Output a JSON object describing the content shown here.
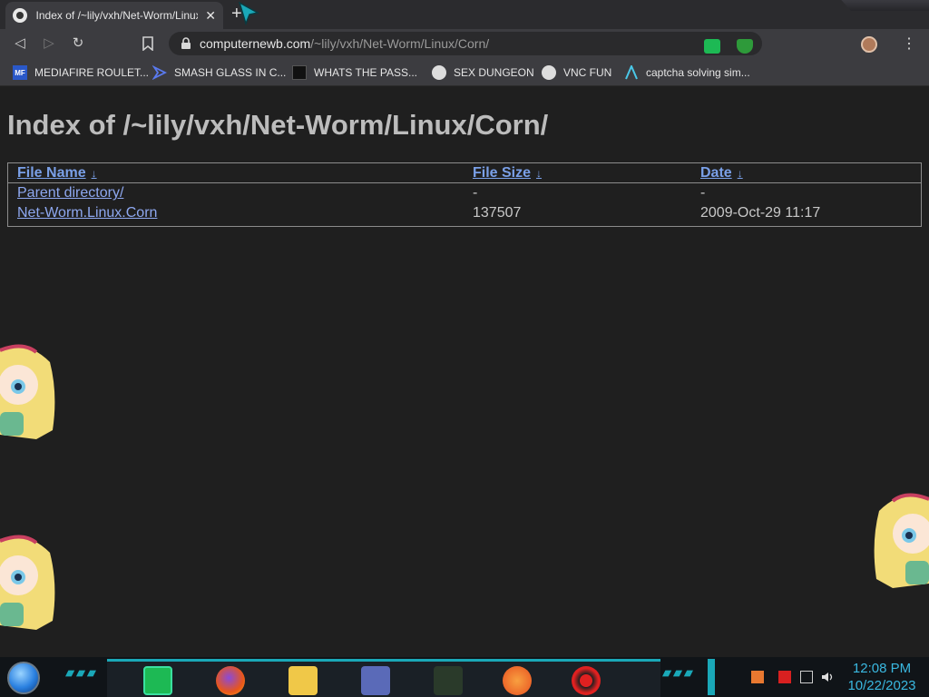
{
  "browser": {
    "tab": {
      "title": "Index of /~lily/vxh/Net-Worm/Linux/Corn/",
      "close_glyph": "✕"
    },
    "new_tab_glyph": "+",
    "nav": {
      "back": "◁",
      "forward": "▷",
      "reload": "↻",
      "bookmark": "🔖"
    },
    "url": {
      "host": "computernewb.com",
      "path": "/~lily/vxh/Net-Worm/Linux/Corn/"
    },
    "menu_glyph": "⋮",
    "bookmarks": [
      {
        "label": "MEDIAFIRE ROULET...",
        "icon": "mediafire-icon",
        "badge": "MF"
      },
      {
        "label": "SMASH GLASS IN C...",
        "icon": "smash-icon",
        "badge": ""
      },
      {
        "label": "WHATS THE PASS...",
        "icon": "lock-icon",
        "badge": ""
      },
      {
        "label": "SEX DUNGEON",
        "icon": "site-icon",
        "badge": ""
      },
      {
        "label": "VNC FUN",
        "icon": "site-icon",
        "badge": ""
      },
      {
        "label": "captcha solving sim...",
        "icon": "caret-icon",
        "badge": ""
      }
    ]
  },
  "page": {
    "heading": "Index of /~lily/vxh/Net-Worm/Linux/Corn/",
    "columns": [
      {
        "label": "File Name",
        "sort": "↓"
      },
      {
        "label": "File Size",
        "sort": "↓"
      },
      {
        "label": "Date",
        "sort": "↓"
      }
    ],
    "rows": [
      {
        "name": "Parent directory/",
        "size": "-",
        "date": "-"
      },
      {
        "name": "Net-Worm.Linux.Corn",
        "size": "137507",
        "date": "2009-Oct-29 11:17"
      }
    ]
  },
  "taskbar": {
    "apps": [
      "notes-app-icon",
      "firefox-icon",
      "file-explorer-icon",
      "app-window-icon",
      "flower-app-icon",
      "p-app-icon",
      "radiation-app-icon"
    ],
    "clock": {
      "time": "12:08 PM",
      "date": "10/22/2023"
    }
  },
  "colors": {
    "link": "#8ea8f0",
    "accent": "#1aa8b8",
    "clock": "#3ab8e0"
  }
}
